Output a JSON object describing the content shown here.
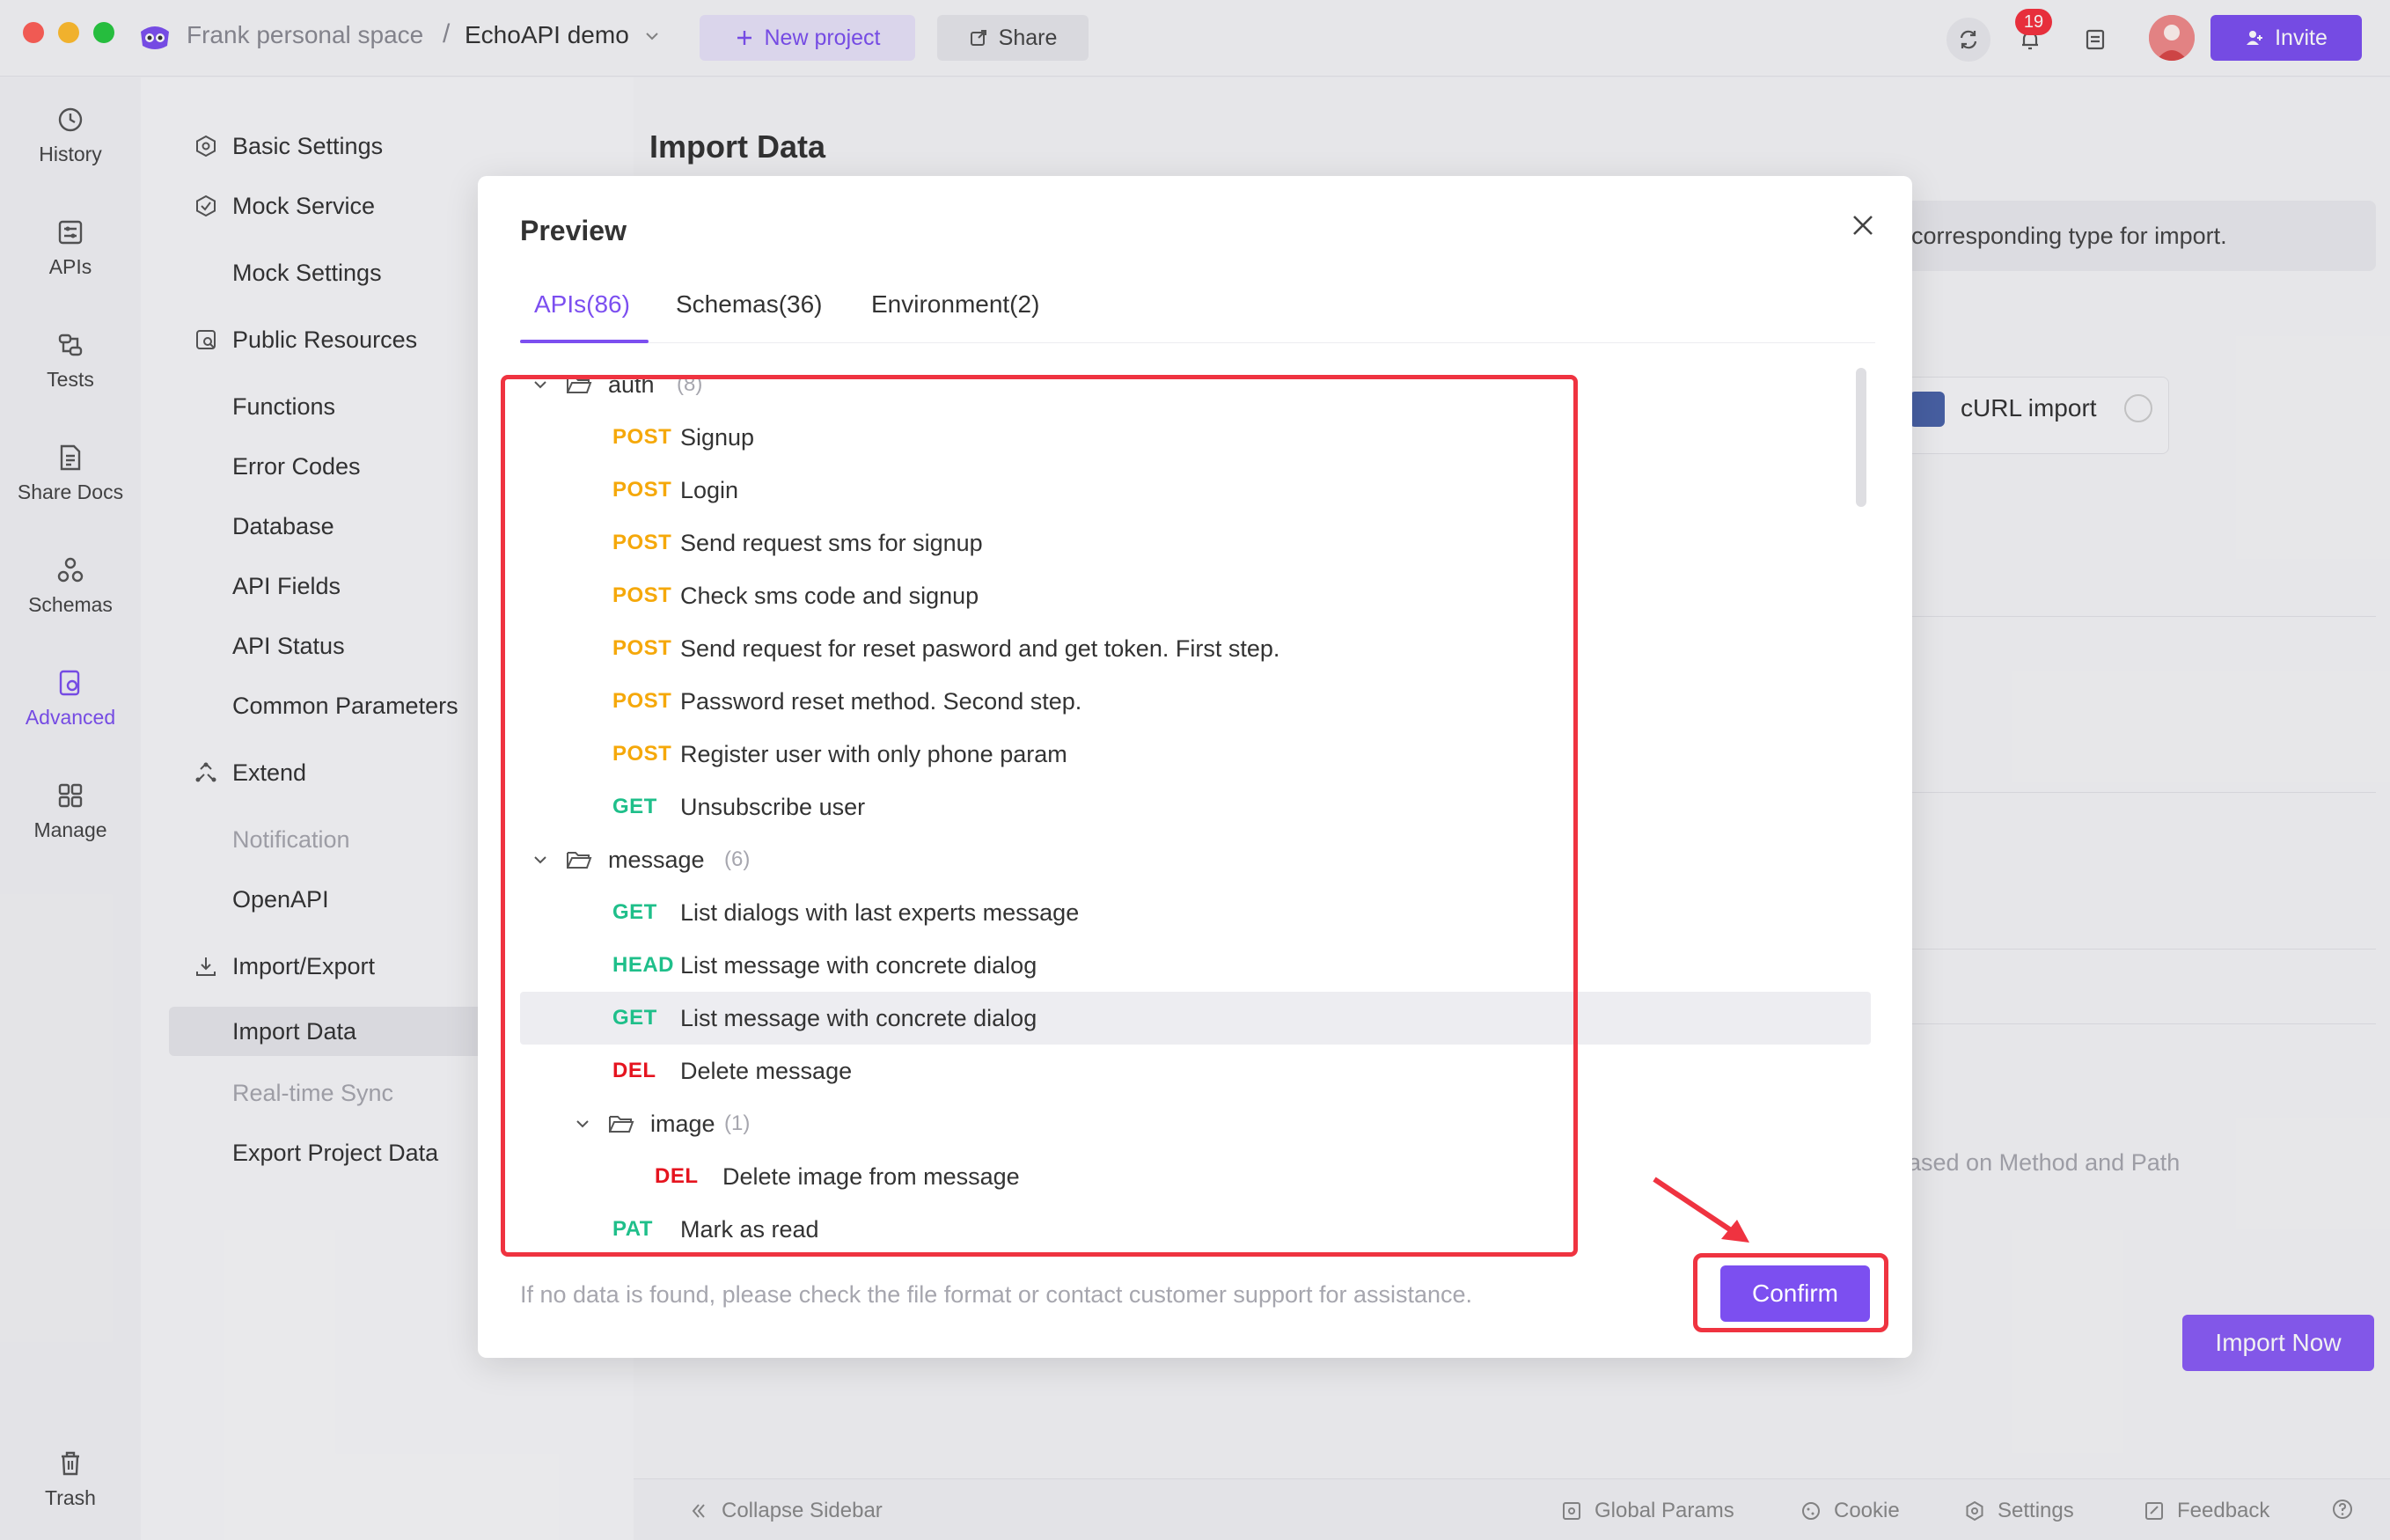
{
  "titlebar": {
    "space": "Frank personal space",
    "separator": "/",
    "project": "EchoAPI demo",
    "new_project": "New project",
    "share": "Share",
    "notifications": "19",
    "invite": "Invite"
  },
  "rail": {
    "history": "History",
    "apis": "APIs",
    "tests": "Tests",
    "share_docs": "Share Docs",
    "schemas": "Schemas",
    "advanced": "Advanced",
    "manage": "Manage",
    "trash": "Trash"
  },
  "nav": {
    "basic_settings": "Basic Settings",
    "mock_service": "Mock Service",
    "mock_settings": "Mock Settings",
    "public_resources": "Public Resources",
    "functions": "Functions",
    "error_codes": "Error Codes",
    "database": "Database",
    "api_fields": "API Fields",
    "api_status": "API Status",
    "common_parameters": "Common Parameters",
    "extend": "Extend",
    "notification": "Notification",
    "openapi": "OpenAPI",
    "import_export": "Import/Export",
    "import_data": "Import Data",
    "realtime_sync": "Real-time Sync",
    "export_project": "Export Project Data"
  },
  "main": {
    "title": "Import Data",
    "hint": "corresponding type for import.",
    "curl_import": "cURL import",
    "duplicate_hint": "ased on Method and Path",
    "import_now": "Import Now"
  },
  "bottombar": {
    "collapse": "Collapse Sidebar",
    "global_params": "Global Params",
    "cookie": "Cookie",
    "settings": "Settings",
    "feedback": "Feedback"
  },
  "modal": {
    "title": "Preview",
    "tabs": [
      "APIs(86)",
      "Schemas(36)",
      "Environment(2)"
    ],
    "footer": "If no data is found, please check the file format or contact customer support for assistance.",
    "confirm": "Confirm",
    "tree": [
      {
        "kind": "folder",
        "name": "auth",
        "count": "(8)"
      },
      {
        "kind": "api",
        "method": "POST",
        "name": "Signup"
      },
      {
        "kind": "api",
        "method": "POST",
        "name": "Login"
      },
      {
        "kind": "api",
        "method": "POST",
        "name": "Send request sms for signup"
      },
      {
        "kind": "api",
        "method": "POST",
        "name": "Check sms code and signup"
      },
      {
        "kind": "api",
        "method": "POST",
        "name": "Send request for reset pasword and get token. First step."
      },
      {
        "kind": "api",
        "method": "POST",
        "name": "Password reset method. Second step."
      },
      {
        "kind": "api",
        "method": "POST",
        "name": "Register user with only phone param"
      },
      {
        "kind": "api",
        "method": "GET",
        "name": "Unsubscribe user"
      },
      {
        "kind": "folder",
        "name": "message",
        "count": "(6)"
      },
      {
        "kind": "api",
        "method": "GET",
        "name": "List dialogs with last experts message"
      },
      {
        "kind": "api",
        "method": "HEAD",
        "name": "List message with concrete dialog"
      },
      {
        "kind": "api",
        "method": "GET",
        "name": "List message with concrete dialog"
      },
      {
        "kind": "api",
        "method": "DEL",
        "name": "Delete message"
      },
      {
        "kind": "folder",
        "name": "image",
        "count": "(1)"
      },
      {
        "kind": "api",
        "method": "DEL",
        "name": "Delete image from message"
      },
      {
        "kind": "api",
        "method": "PAT",
        "name": "Mark as read"
      }
    ]
  },
  "colors": {
    "accent": "#7c4ff0",
    "post": "#f5a80a",
    "get": "#1fbf8a",
    "del": "#e5141f",
    "annotation": "#ef3340"
  }
}
